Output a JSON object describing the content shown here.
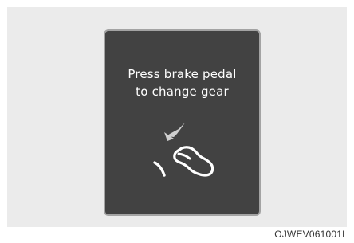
{
  "display": {
    "message_line1": "Press brake pedal",
    "message_line2": "to change gear",
    "icon": "brake-pedal-press-icon"
  },
  "caption": "OJWEV061001L",
  "colors": {
    "backdrop": "#ebebeb",
    "display_bg": "#424242",
    "display_border": "#a3a3a3",
    "text": "#ffffff"
  }
}
